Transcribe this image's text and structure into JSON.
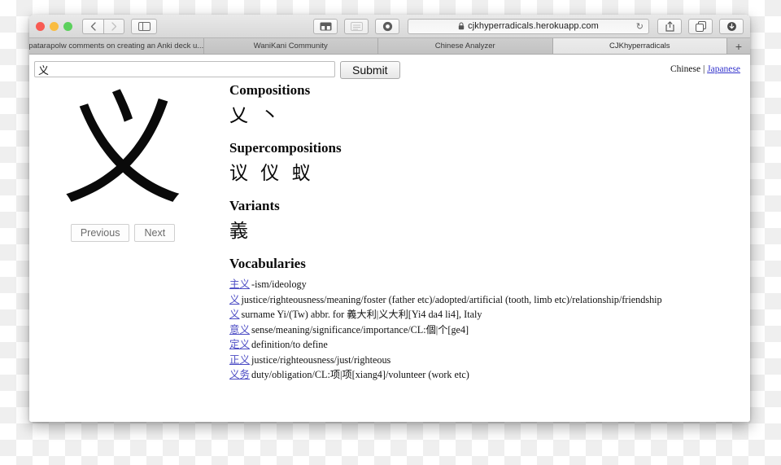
{
  "browser": {
    "window_controls": [
      "close",
      "minimize",
      "maximize"
    ],
    "nav": {
      "back": "‹",
      "forward": "›",
      "sidebar": "sidebar-icon"
    },
    "toolbar_icons": [
      "bookmarks-icon",
      "reader-icon",
      "airdrop-icon",
      "share-icon",
      "tabs-icon",
      "downloads-icon"
    ],
    "url": "cjkhyperradicals.herokuapp.com",
    "lock": "lock-icon",
    "reload": "↻",
    "tabs": [
      {
        "label": "patarapolw comments on creating an Anki deck u...",
        "active": false
      },
      {
        "label": "WaniKani Community",
        "active": false
      },
      {
        "label": "Chinese Analyzer",
        "active": false
      },
      {
        "label": "CJKhyperradicals",
        "active": true
      }
    ],
    "new_tab": "+"
  },
  "page": {
    "search": {
      "value": "义",
      "placeholder": ""
    },
    "submit_label": "Submit",
    "language": {
      "current": "Chinese",
      "separator": "|",
      "alternate": "Japanese"
    },
    "main_character": "义",
    "previous_label": "Previous",
    "next_label": "Next",
    "sections": [
      {
        "title": "Compositions",
        "characters": "乂 丶"
      },
      {
        "title": "Supercompositions",
        "characters": "议 仪 蚁"
      },
      {
        "title": "Variants",
        "characters": "義"
      }
    ],
    "vocabularies_title": "Vocabularies",
    "vocabularies": [
      {
        "word": "主义",
        "definition": "-ism/ideology"
      },
      {
        "word": "义",
        "definition": "justice/righteousness/meaning/foster (father etc)/adopted/artificial (tooth, limb etc)/relationship/friendship"
      },
      {
        "word": "义",
        "definition": "surname Yi/(Tw) abbr. for 義大利|义大利[Yi4 da4 li4], Italy"
      },
      {
        "word": "意义",
        "definition": "sense/meaning/significance/importance/CL:個|个[ge4]"
      },
      {
        "word": "定义",
        "definition": "definition/to define"
      },
      {
        "word": "正义",
        "definition": "justice/righteousness/just/righteous"
      },
      {
        "word": "义务",
        "definition": "duty/obligation/CL:项|项[xiang4]/volunteer (work etc)"
      }
    ]
  },
  "colors": {
    "link": "#4b4bc4",
    "lang_link": "#3333cc",
    "text": "#111111"
  }
}
